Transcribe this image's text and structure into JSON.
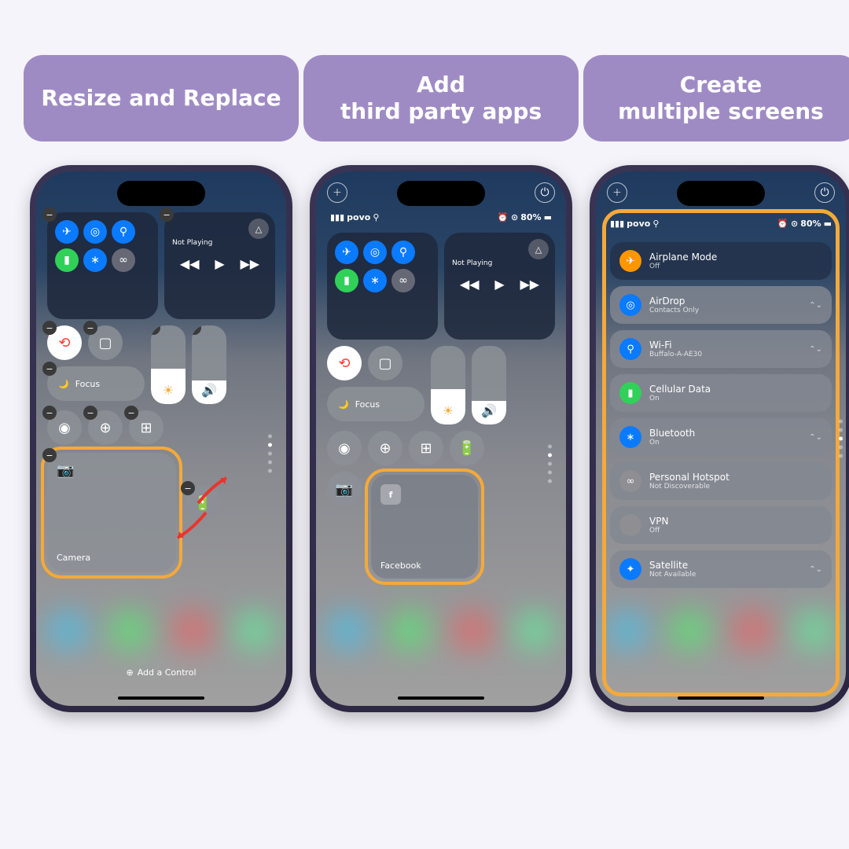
{
  "badges": [
    "Resize and Replace",
    "Add\nthird party apps",
    "Create\nmultiple screens"
  ],
  "status": {
    "carrier": "povo",
    "battery": "80%"
  },
  "media": {
    "title": "Not Playing"
  },
  "focus": "Focus",
  "camera": "Camera",
  "facebook": "Facebook",
  "addControl": "Add a Control",
  "list": [
    {
      "title": "Airplane Mode",
      "sub": "Off",
      "color": "#ff9500",
      "icon": "✈"
    },
    {
      "title": "AirDrop",
      "sub": "Contacts Only",
      "color": "#0a7aff",
      "icon": "◎",
      "chev": true
    },
    {
      "title": "Wi-Fi",
      "sub": "Buffalo-A-AE30",
      "color": "#0a7aff",
      "icon": "⚲",
      "chev": true
    },
    {
      "title": "Cellular Data",
      "sub": "On",
      "color": "#30d158",
      "icon": "▮"
    },
    {
      "title": "Bluetooth",
      "sub": "On",
      "color": "#0a7aff",
      "icon": "∗",
      "chev": true
    },
    {
      "title": "Personal Hotspot",
      "sub": "Not Discoverable",
      "color": "#8e8e93",
      "icon": "∞"
    },
    {
      "title": "VPN",
      "sub": "Off",
      "color": "#8e8e93",
      "icon": ""
    },
    {
      "title": "Satellite",
      "sub": "Not Available",
      "color": "#0a7aff",
      "icon": "✦",
      "chev": true
    }
  ]
}
